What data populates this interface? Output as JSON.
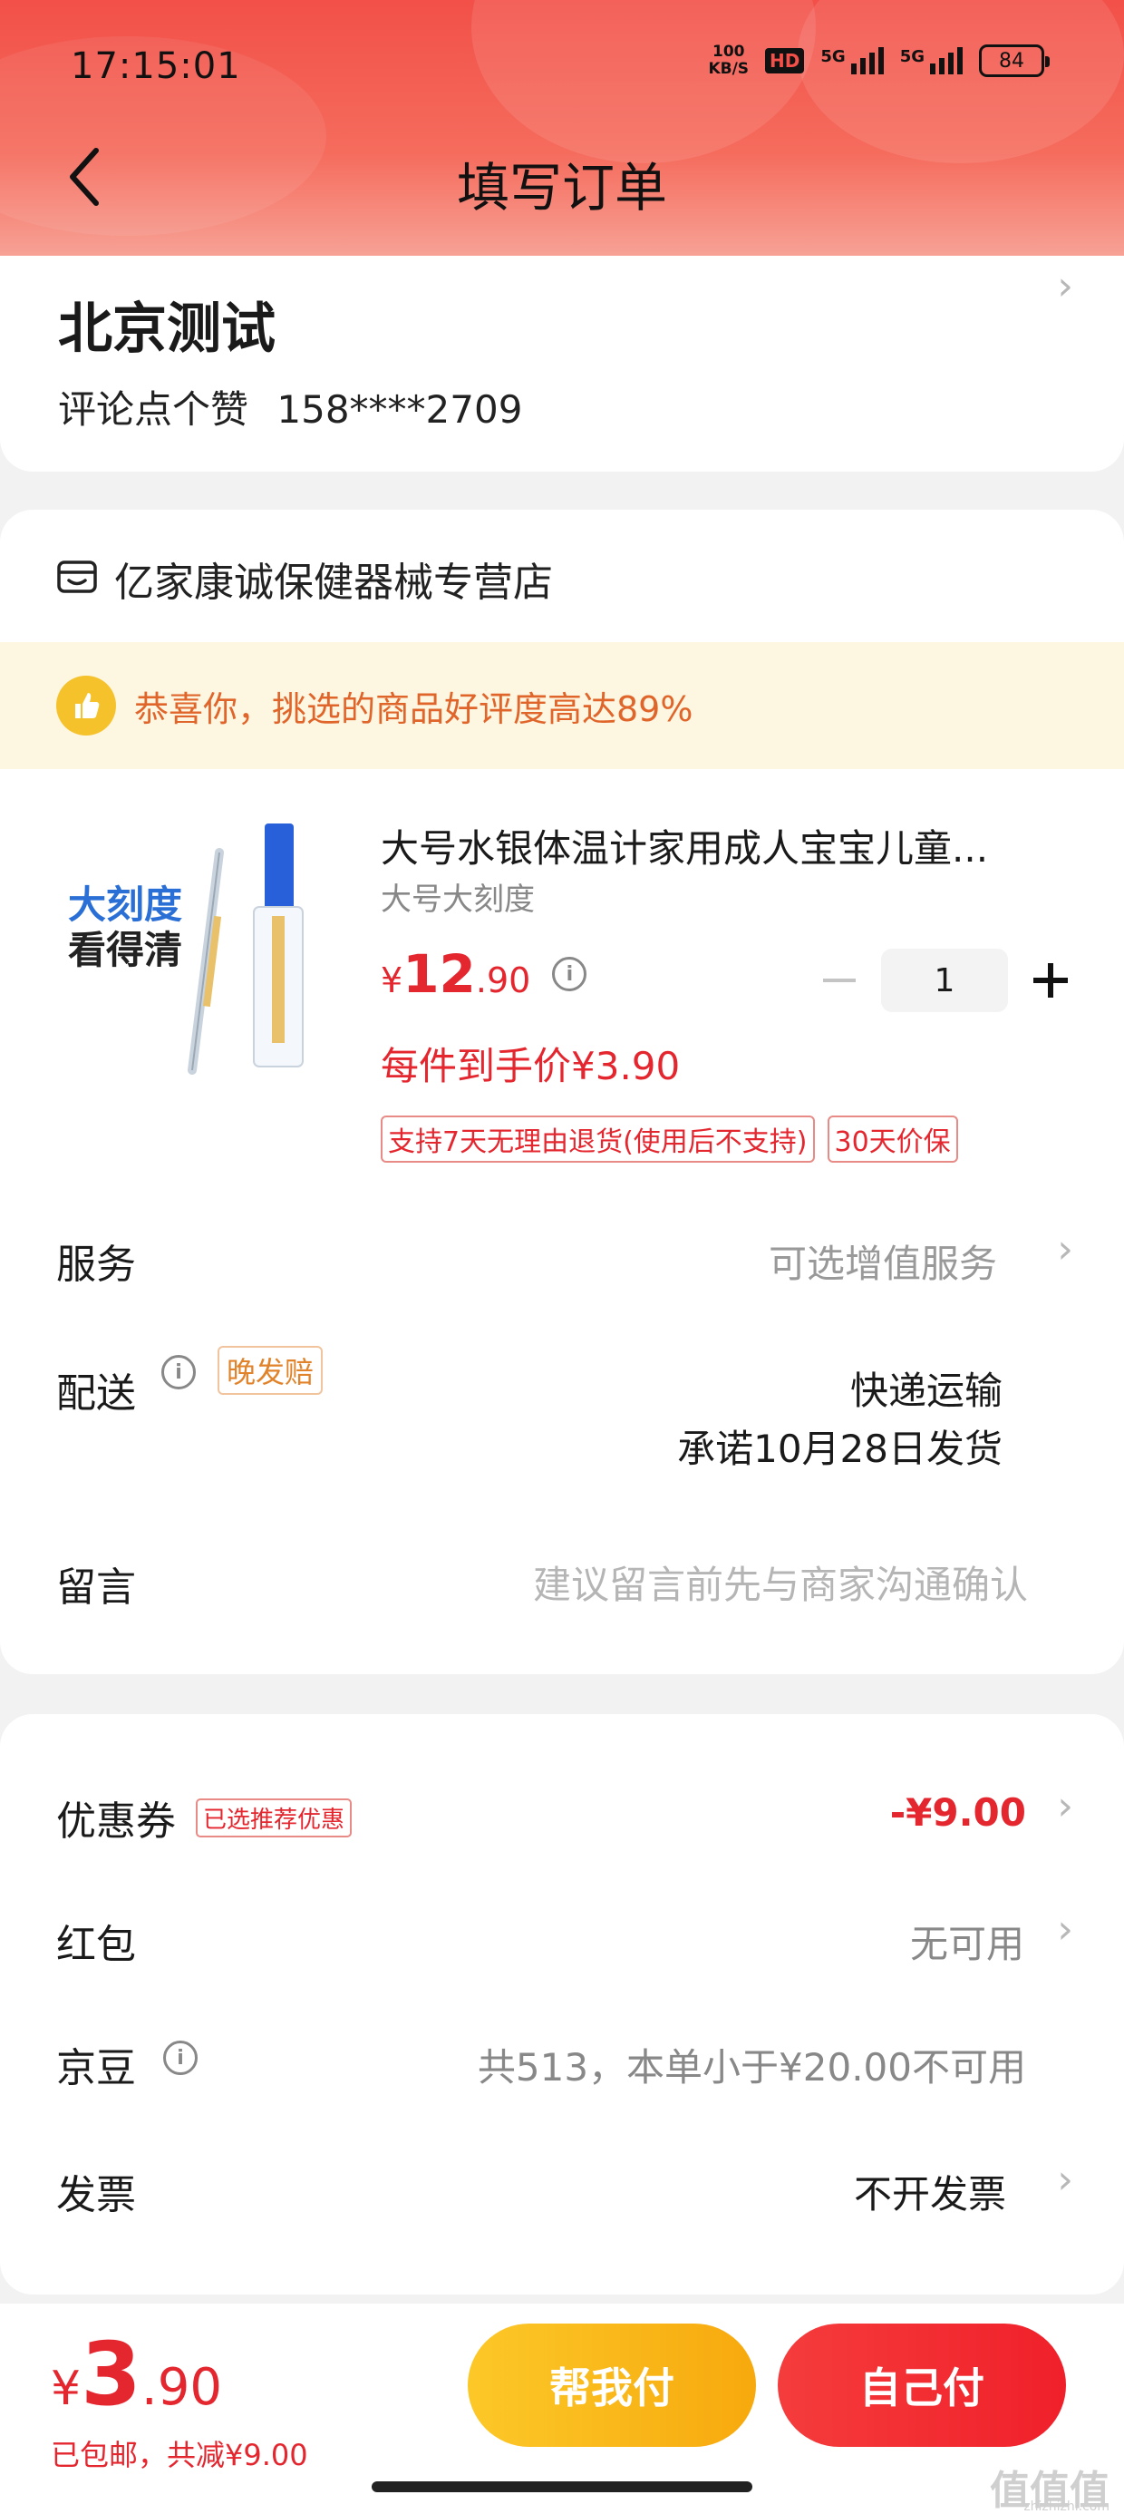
{
  "status": {
    "time": "17:15:01",
    "speed": "100",
    "speed_unit": "KB/S",
    "hd": "HD",
    "net1": "5G",
    "net2": "5G",
    "battery": "84"
  },
  "header": {
    "title": "填写订单",
    "back_icon": "chevron-left-icon"
  },
  "address": {
    "name": "北京测试",
    "contact": "评论点个赞",
    "phone": "158****2709"
  },
  "shop": {
    "name": "亿家康诚保健器械专营店",
    "banner_text": "恭喜你，挑选的商品好评度高达89%"
  },
  "product": {
    "image_text_line1": "大刻度",
    "image_text_line2": "看得清",
    "title": "大号水银体温计家用成人宝宝儿童...",
    "spec": "大号大刻度",
    "price_currency": "¥",
    "price_int": "12",
    "price_dec": ".90",
    "quantity": "1",
    "unit_price": "每件到手价¥3.90",
    "tags": [
      "支持7天无理由退货(使用后不支持)",
      "30天价保"
    ]
  },
  "rows": {
    "service_label": "服务",
    "service_value": "可选增值服务",
    "delivery_label": "配送",
    "delivery_tag": "晚发赔",
    "delivery_method": "快递运输",
    "delivery_promise": "承诺10月28日发货",
    "message_label": "留言",
    "message_placeholder": "建议留言前先与商家沟通确认"
  },
  "discounts": {
    "coupon_label": "优惠券",
    "coupon_tag": "已选推荐优惠",
    "coupon_value": "-¥9.00",
    "redpacket_label": "红包",
    "redpacket_value": "无可用",
    "jingdou_label": "京豆",
    "jingdou_value": "共513，本单小于¥20.00不可用",
    "invoice_label": "发票",
    "invoice_value": "不开发票"
  },
  "footer": {
    "currency": "¥",
    "total_int": "3",
    "total_dec": ".90",
    "note": "已包邮，共减¥9.00",
    "help_pay": "帮我付",
    "self_pay": "自己付"
  },
  "watermark": {
    "text": "值值值",
    "sub": "zhizhizhi.com"
  },
  "colors": {
    "accent_red": "#e4262f",
    "header_red": "#f25048",
    "help_yellow": "#fcc828",
    "banner_bg": "#fdf6e0"
  }
}
